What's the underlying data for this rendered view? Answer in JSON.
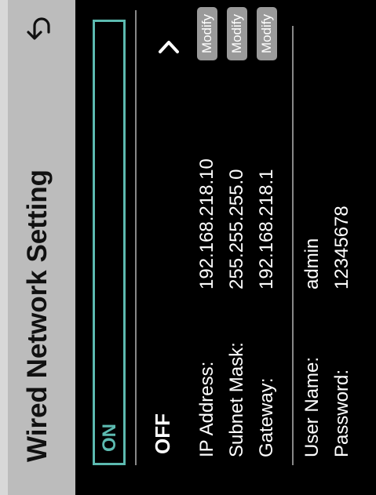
{
  "header": {
    "title": "Wired Network Setting",
    "back_icon": "undo-arrow-icon"
  },
  "dhcp": {
    "on_label": "ON",
    "off_label": "OFF",
    "chevron_icon": "chevron-right-icon",
    "selected": "ON"
  },
  "network": {
    "rows": [
      {
        "label": "IP Address:",
        "value": "192.168.218.10",
        "action": "Modify"
      },
      {
        "label": "Subnet Mask:",
        "value": "255.255.255.0",
        "action": "Modify"
      },
      {
        "label": "Gateway:",
        "value": "192.168.218.1",
        "action": "Modify"
      }
    ]
  },
  "credentials": {
    "rows": [
      {
        "label": "User Name:",
        "value": "admin"
      },
      {
        "label": "Password:",
        "value": "12345678"
      }
    ]
  },
  "colors": {
    "header_bg": "#bcbcbc",
    "accent": "#5cbab0",
    "background": "#000000",
    "button_bg": "#9a9a9a"
  }
}
